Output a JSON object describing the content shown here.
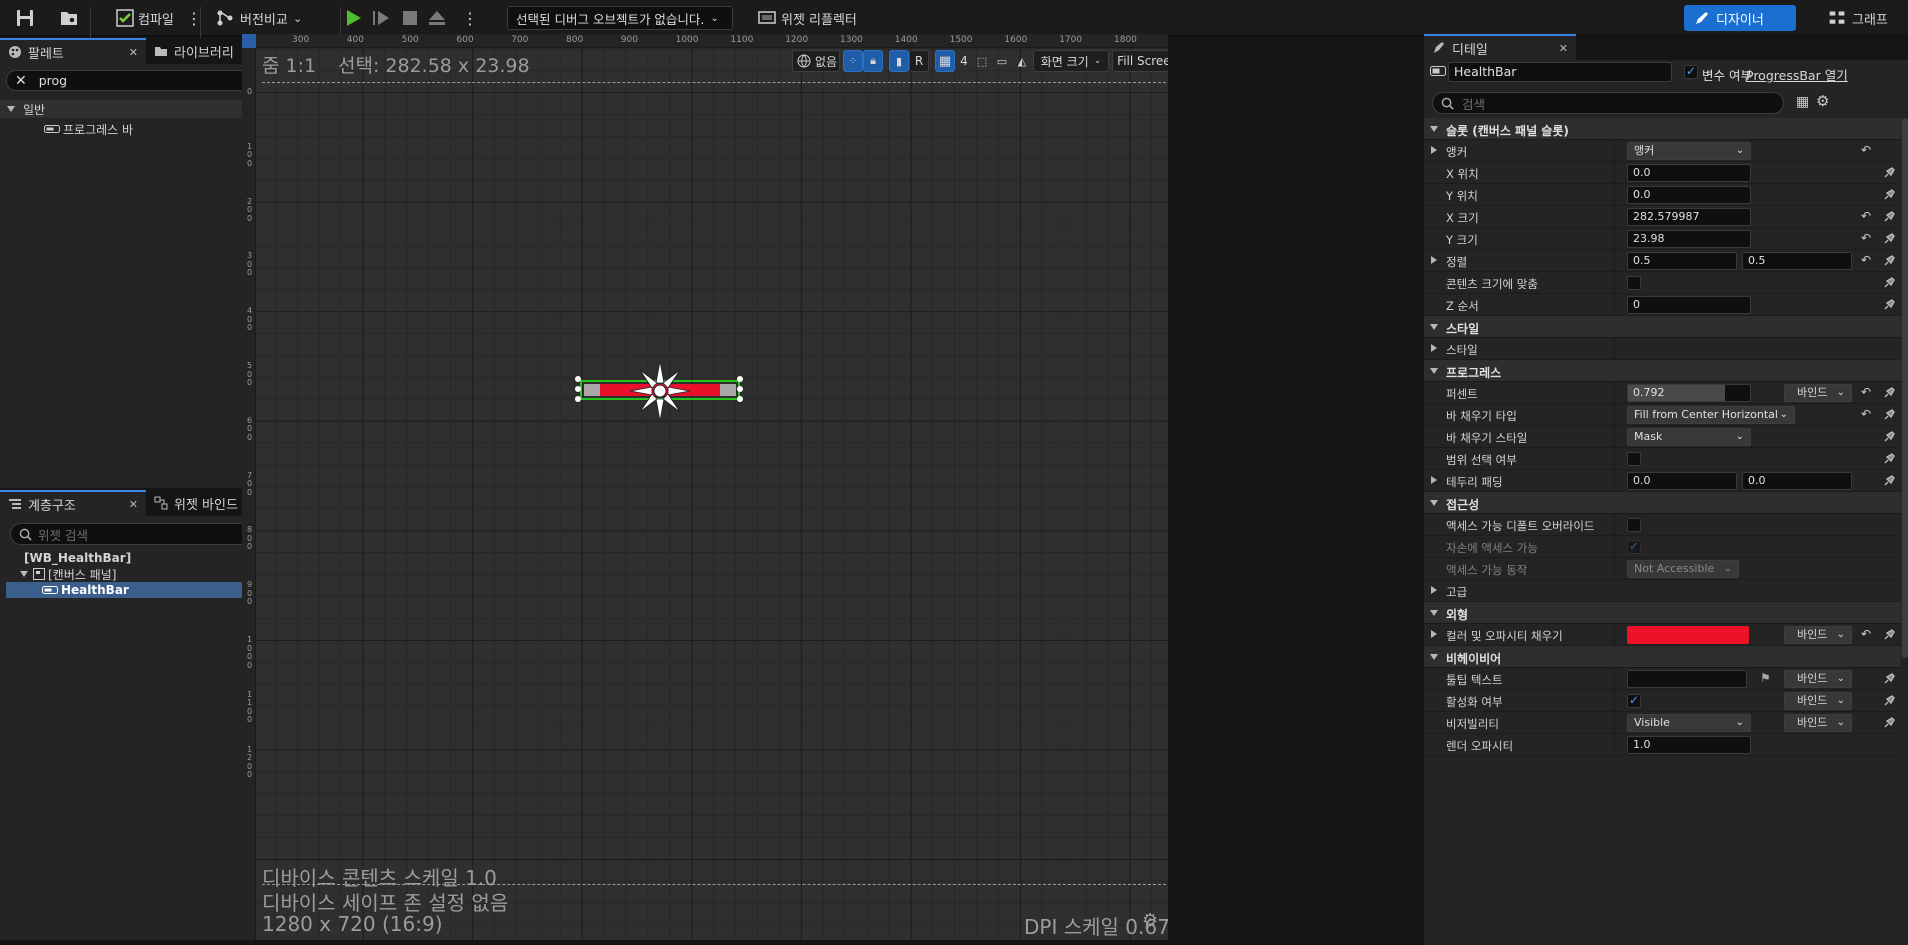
{
  "toolbar": {
    "compile_label": "컴파일",
    "version_label": "버전비교",
    "debug_object": "선택된 디버그 오브젝트가 없습니다.",
    "widget_reflector": "위젯 리플렉터",
    "designer_label": "디자이너",
    "graph_label": "그래프"
  },
  "palette": {
    "tabs": [
      {
        "label": "팔레트"
      },
      {
        "label": "라이브러리"
      }
    ],
    "search_value": "prog",
    "category": "일반",
    "items": [
      {
        "label": "프로그레스 바"
      }
    ]
  },
  "hierarchy": {
    "tabs": [
      {
        "label": "계층구조"
      },
      {
        "label": "위젯 바인드"
      }
    ],
    "search_placeholder": "위젯 검색",
    "root": "[WB_HealthBar]",
    "items": [
      {
        "label": "[캔버스 패널]"
      },
      {
        "label": "HealthBar"
      }
    ]
  },
  "canvas": {
    "zoom": "줌 1:1",
    "selection": "선택: 282.58 x 23.98",
    "ruler_top": [
      "300",
      "400",
      "500",
      "600",
      "700",
      "800",
      "900",
      "1000",
      "1100",
      "1200",
      "1300",
      "1400",
      "1500",
      "1600",
      "1700",
      "1800"
    ],
    "ruler_left": [
      "0",
      "100",
      "200",
      "300",
      "400",
      "500",
      "600",
      "700",
      "800",
      "900",
      "1000",
      "1100",
      "1200"
    ],
    "toolbar": {
      "none_label": "없음",
      "r_label": "R",
      "grid_value": "4",
      "screen_size": "화면 크기",
      "fill_screen": "Fill Screen"
    },
    "content_scale": "디바이스 콘텐츠 스케일 1.0",
    "safe_zone": "디바이스 세이프 존 설정 없음",
    "resolution": "1280 x 720 (16:9)",
    "dpi": "DPI 스케일 0.67",
    "progress_bar": {
      "percent": 0.792,
      "fill_color": "#e8102a"
    }
  },
  "details": {
    "tab": "디테일",
    "name_value": "HealthBar",
    "is_variable": "변수 여부",
    "open_link": "ProgressBar 열기",
    "search_placeholder": "검색",
    "sections": {
      "slot": "슬롯 (캔버스 패널 슬롯)",
      "style": "스타일",
      "progress": "프로그레스",
      "accessibility": "접근성",
      "advanced": "고급",
      "appearance": "외형",
      "behavior": "비헤이비어"
    },
    "props": {
      "anchor": {
        "label": "앵커",
        "value": "앵커"
      },
      "x_pos": {
        "label": "X 위치",
        "value": "0.0"
      },
      "y_pos": {
        "label": "Y 위치",
        "value": "0.0"
      },
      "x_size": {
        "label": "X 크기",
        "value": "282.579987"
      },
      "y_size": {
        "label": "Y 크기",
        "value": "23.98"
      },
      "alignment": {
        "label": "정렬",
        "x": "0.5",
        "y": "0.5"
      },
      "size_to_content": {
        "label": "콘텐츠 크기에 맞춤"
      },
      "z_order": {
        "label": "Z 순서",
        "value": "0"
      },
      "style": {
        "label": "스타일"
      },
      "percent": {
        "label": "퍼센트",
        "value": "0.792"
      },
      "bar_fill_type": {
        "label": "바 채우기 타입",
        "value": "Fill from Center Horizontal"
      },
      "bar_fill_style": {
        "label": "바 채우기 스타일",
        "value": "Mask"
      },
      "is_marquee": {
        "label": "범위 선택 여부"
      },
      "border_padding": {
        "label": "테두리 패딩",
        "x": "0.0",
        "y": "0.0"
      },
      "override_access": {
        "label": "액세스 가능 디폴트 오버라이드"
      },
      "children_access": {
        "label": "자손에 액세스 가능"
      },
      "access_behavior": {
        "label": "액세스 가능 동작",
        "value": "Not Accessible"
      },
      "color_opacity": {
        "label": "컬러 및 오파시티 채우기",
        "color": "#ee1228"
      },
      "tooltip": {
        "label": "툴팁 텍스트",
        "value": ""
      },
      "is_enabled": {
        "label": "활성화 여부"
      },
      "visibility": {
        "label": "비저빌리티",
        "value": "Visible"
      },
      "render_opacity": {
        "label": "렌더 오파시티",
        "value": "1.0"
      }
    },
    "bind_label": "바인드"
  }
}
